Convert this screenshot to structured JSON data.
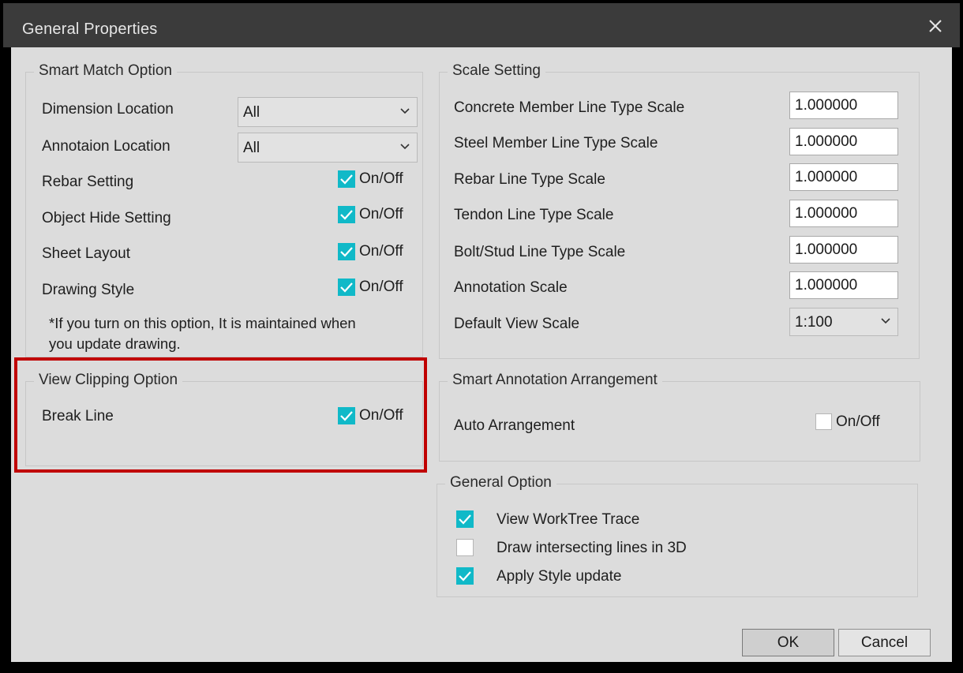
{
  "window": {
    "title": "General Properties"
  },
  "smart_match": {
    "title": "Smart Match Option",
    "dimension_location": {
      "label": "Dimension Location",
      "value": "All"
    },
    "annotation_location": {
      "label": "Annotaion Location",
      "value": "All"
    },
    "toggle_label": "On/Off",
    "rebar_setting": {
      "label": "Rebar Setting",
      "checked": true
    },
    "object_hide_setting": {
      "label": "Object Hide Setting",
      "checked": true
    },
    "sheet_layout": {
      "label": "Sheet Layout",
      "checked": true
    },
    "drawing_style": {
      "label": "Drawing Style",
      "checked": true
    },
    "note_line1": "*If you turn on this option, It is maintained when",
    "note_line2": "you update drawing."
  },
  "view_clipping": {
    "title": "View Clipping Option",
    "break_line": {
      "label": "Break Line",
      "checked": true
    },
    "toggle_label": "On/Off"
  },
  "scale_setting": {
    "title": "Scale Setting",
    "concrete": {
      "label": "Concrete Member Line Type Scale",
      "value": "1.000000"
    },
    "steel": {
      "label": "Steel Member Line Type Scale",
      "value": "1.000000"
    },
    "rebar": {
      "label": "Rebar Line Type Scale",
      "value": "1.000000"
    },
    "tendon": {
      "label": "Tendon Line Type Scale",
      "value": "1.000000"
    },
    "bolt": {
      "label": "Bolt/Stud Line Type Scale",
      "value": "1.000000"
    },
    "annotation": {
      "label": "Annotation Scale",
      "value": "1.000000"
    },
    "default_view": {
      "label": "Default View Scale",
      "value": "1:100"
    }
  },
  "smart_annotation": {
    "title": "Smart Annotation Arrangement",
    "auto_arrangement": {
      "label": "Auto Arrangement",
      "checked": false
    },
    "toggle_label": "On/Off"
  },
  "general_option": {
    "title": "General Option",
    "view_worktree_trace": {
      "label": "View WorkTree Trace",
      "checked": true
    },
    "draw_intersecting": {
      "label": "Draw intersecting lines in 3D",
      "checked": false
    },
    "apply_style_update": {
      "label": "Apply Style update",
      "checked": true
    }
  },
  "buttons": {
    "ok": "OK",
    "cancel": "Cancel"
  },
  "colors": {
    "checkbox_on": "#10b9c8",
    "highlight": "#c00000",
    "titlebar": "#3b3b3b"
  }
}
